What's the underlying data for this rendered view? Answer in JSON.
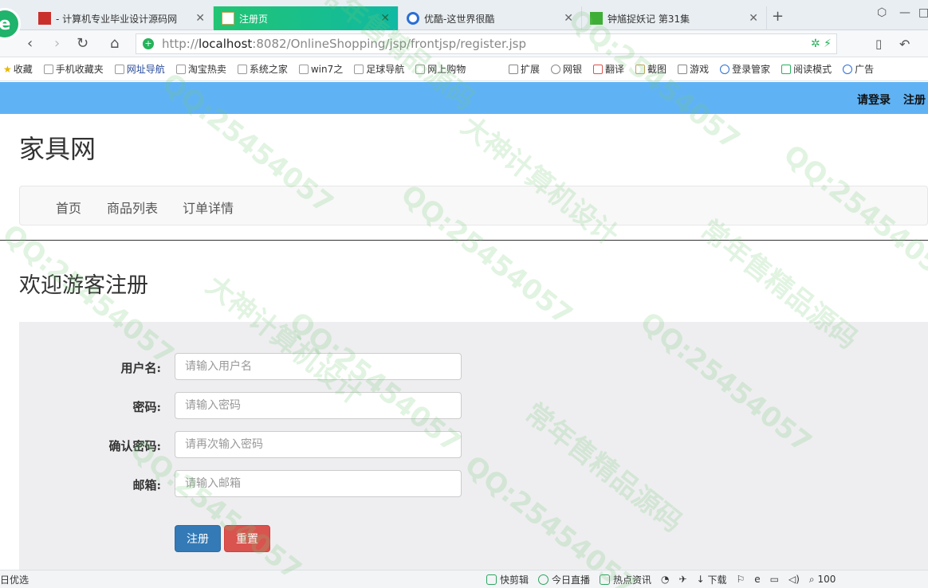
{
  "browser": {
    "tabs": [
      {
        "title": "- 计算机专业毕业设计源码网",
        "favicon": "red-square-icon"
      },
      {
        "title": "注册页",
        "favicon": "page-icon",
        "active": true
      },
      {
        "title": "优酷-这世界很酷",
        "favicon": "youku-icon"
      },
      {
        "title": "钟馗捉妖记 第31集",
        "favicon": "iqiyi-icon"
      }
    ],
    "url": {
      "scheme": "http://",
      "host": "localhost",
      "rest": ":8082/OnlineShopping/jsp/frontjsp/register.jsp"
    },
    "bookmarks": [
      "收藏",
      "手机收藏夹",
      "网址导航",
      "淘宝热卖",
      "系统之家",
      "win7之",
      "足球导航",
      "网上购物"
    ],
    "bookmarks_right": [
      "扩展",
      "网银",
      "翻译",
      "截图",
      "游戏",
      "登录管家",
      "阅读模式",
      "广告"
    ],
    "status_left": "日优选",
    "status_items": [
      "快剪辑",
      "今日直播",
      "热点资讯",
      "下载",
      "100"
    ]
  },
  "topbar": {
    "login": "请登录",
    "register": "注册",
    "color": "#5fb3f5"
  },
  "site": {
    "title": "家具网"
  },
  "nav": {
    "items": [
      "首页",
      "商品列表",
      "订单详情"
    ]
  },
  "page": {
    "heading": "欢迎游客注册"
  },
  "form": {
    "username": {
      "label": "用户名:",
      "placeholder": "请输入用户名"
    },
    "password": {
      "label": "密码:",
      "placeholder": "请输入密码"
    },
    "confirm": {
      "label": "确认密码:",
      "placeholder": "请再次输入密码"
    },
    "email": {
      "label": "邮箱:",
      "placeholder": "请输入邮箱"
    },
    "submit": "注册",
    "reset": "重置"
  },
  "watermark": {
    "texts": [
      "QQ:25454057",
      "大神计算机设计",
      "常年售精品源码"
    ]
  }
}
